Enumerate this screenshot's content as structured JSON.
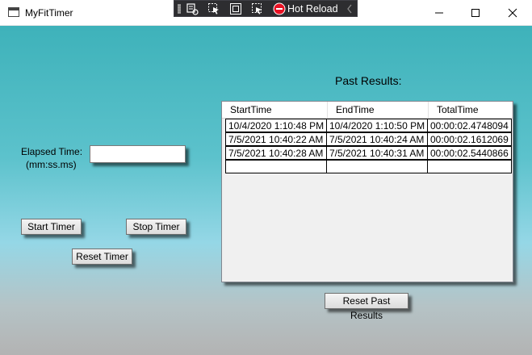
{
  "window": {
    "title": "MyFitTimer",
    "controls": {
      "minimize": "minimize",
      "maximize": "maximize",
      "close": "close"
    }
  },
  "debug_toolbar": {
    "hot_reload_label": "Hot Reload",
    "icons": [
      "live-visual-tree-icon",
      "select-element-icon",
      "display-layout-adorners-icon",
      "track-focus-icon",
      "hot-reload-status-icon",
      "collapse-chevron-icon"
    ]
  },
  "timer": {
    "elapsed_label_line1": "Elapsed Time:",
    "elapsed_label_line2": "(mm:ss.ms)",
    "elapsed_value": "",
    "start_button": "Start Timer",
    "stop_button": "Stop Timer",
    "reset_button": "Reset Timer"
  },
  "results": {
    "heading": "Past Results:",
    "columns": [
      "StartTime",
      "EndTime",
      "TotalTime"
    ],
    "rows": [
      [
        "10/4/2020 1:10:48 PM",
        "10/4/2020 1:10:50 PM",
        "00:00:02.4748094"
      ],
      [
        "7/5/2021 10:40:22 AM",
        "7/5/2021 10:40:24 AM",
        "00:00:02.1612069"
      ],
      [
        "7/5/2021 10:40:28 AM",
        "7/5/2021 10:40:31 AM",
        "00:00:02.5440866"
      ],
      [
        "",
        "",
        ""
      ]
    ],
    "reset_button": "Reset Past Results"
  },
  "colors": {
    "background_top": "#3eb2ba",
    "background_mid": "#95d7e6",
    "background_bottom": "#b3b3b3",
    "toolbar_bg": "#2d2d30",
    "hot_reload_icon": "#e81123"
  }
}
